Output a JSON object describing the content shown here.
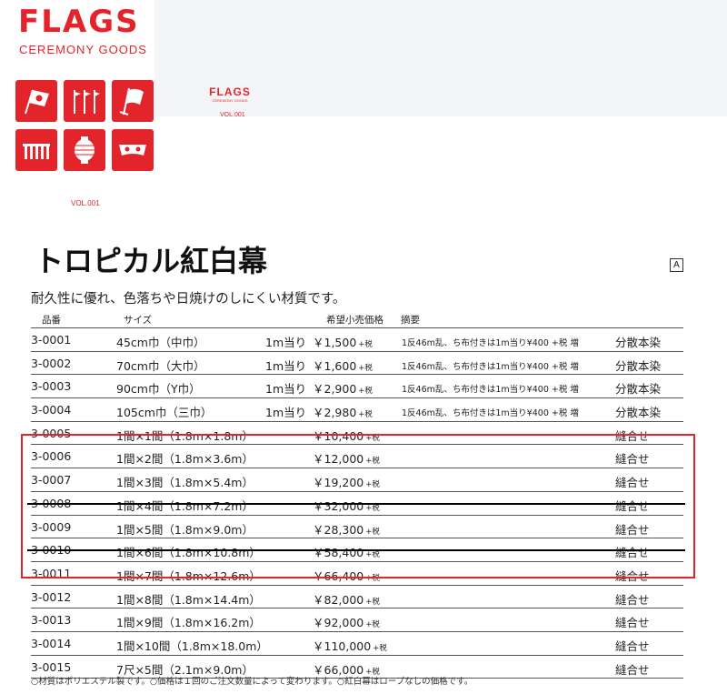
{
  "brand": {
    "word": "FLAGS",
    "sub": "CEREMONY GOODS",
    "vol": "VOL.001"
  },
  "mini_brand": {
    "word": "FLAGS",
    "sub": "CEREMONY GOODS",
    "vol": "VOL.001"
  },
  "icons": [
    "flag-icon",
    "banner-flags-icon",
    "waving-flag-icon",
    "fence-icon",
    "lantern-icon",
    "eye-mask-icon"
  ],
  "accent_color": "#e3242b",
  "title": "トロピカル紅白幕",
  "badge": "A",
  "subtitle": "耐久性に優れ、色落ちや日焼けのしにくい材質です。",
  "columns": {
    "code": "品番",
    "size": "サイズ",
    "price": "希望小売価格",
    "note": "摘要"
  },
  "tax_label": "+税",
  "rows": [
    {
      "code": "3-0001",
      "size": "45cm巾（中巾）",
      "unit": "1m当り",
      "price": "￥1,500",
      "tax": "+税",
      "note": "1反46m乱、ち布付きは1m当り¥400 +税 増",
      "method": "分散本染",
      "struck": false
    },
    {
      "code": "3-0002",
      "size": "70cm巾（大巾）",
      "unit": "1m当り",
      "price": "￥1,600",
      "tax": "+税",
      "note": "1反46m乱、ち布付きは1m当り¥400 +税 増",
      "method": "分散本染",
      "struck": false
    },
    {
      "code": "3-0003",
      "size": "90cm巾（Y巾）",
      "unit": "1m当り",
      "price": "￥2,900",
      "tax": "+税",
      "note": "1反46m乱、ち布付きは1m当り¥400 +税 増",
      "method": "分散本染",
      "struck": false
    },
    {
      "code": "3-0004",
      "size": "105cm巾（三巾）",
      "unit": "1m当り",
      "price": "￥2,980",
      "tax": "+税",
      "note": "1反46m乱、ち布付きは1m当り¥400 +税 増",
      "method": "分散本染",
      "struck": false
    },
    {
      "code": "3-0005",
      "size": "1間×1間（1.8m×1.8m）",
      "unit": "",
      "price": "￥10,400",
      "tax": "+税",
      "note": "",
      "method": "縫合せ",
      "struck": false
    },
    {
      "code": "3-0006",
      "size": "1間×2間（1.8m×3.6m）",
      "unit": "",
      "price": "￥12,000",
      "tax": "+税",
      "note": "",
      "method": "縫合せ",
      "struck": false
    },
    {
      "code": "3-0007",
      "size": "1間×3間（1.8m×5.4m）",
      "unit": "",
      "price": "￥19,200",
      "tax": "+税",
      "note": "",
      "method": "縫合せ",
      "struck": false
    },
    {
      "code": "3-0008",
      "size": "1間×4間（1.8m×7.2m）",
      "unit": "",
      "price": "￥32,000",
      "tax": "+税",
      "note": "",
      "method": "縫合せ",
      "struck": true
    },
    {
      "code": "3-0009",
      "size": "1間×5間（1.8m×9.0m）",
      "unit": "",
      "price": "￥28,300",
      "tax": "+税",
      "note": "",
      "method": "縫合せ",
      "struck": false
    },
    {
      "code": "3-0010",
      "size": "1間×6間（1.8m×10.8m）",
      "unit": "",
      "price": "￥58,400",
      "tax": "+税",
      "note": "",
      "method": "縫合せ",
      "struck": true
    },
    {
      "code": "3-0011",
      "size": "1間×7間（1.8m×12.6m）",
      "unit": "",
      "price": "￥66,400",
      "tax": "+税",
      "note": "",
      "method": "縫合せ",
      "struck": false
    },
    {
      "code": "3-0012",
      "size": "1間×8間（1.8m×14.4m）",
      "unit": "",
      "price": "￥82,000",
      "tax": "+税",
      "note": "",
      "method": "縫合せ",
      "struck": false
    },
    {
      "code": "3-0013",
      "size": "1間×9間（1.8m×16.2m）",
      "unit": "",
      "price": "￥92,000",
      "tax": "+税",
      "note": "",
      "method": "縫合せ",
      "struck": false
    },
    {
      "code": "3-0014",
      "size": "1間×10間（1.8m×18.0m）",
      "unit": "",
      "price": "￥110,000",
      "tax": "+税",
      "note": "",
      "method": "縫合せ",
      "struck": false
    },
    {
      "code": "3-0015",
      "size": "7尺×5間（2.1m×9.0m）",
      "unit": "",
      "price": "￥66,000",
      "tax": "+税",
      "note": "",
      "method": "縫合せ",
      "struck": false
    }
  ],
  "footer": "○材質はポリエステル製です。○価格は１回のご注文数量によって変わります。○紅白幕はロープなしの価格です。"
}
